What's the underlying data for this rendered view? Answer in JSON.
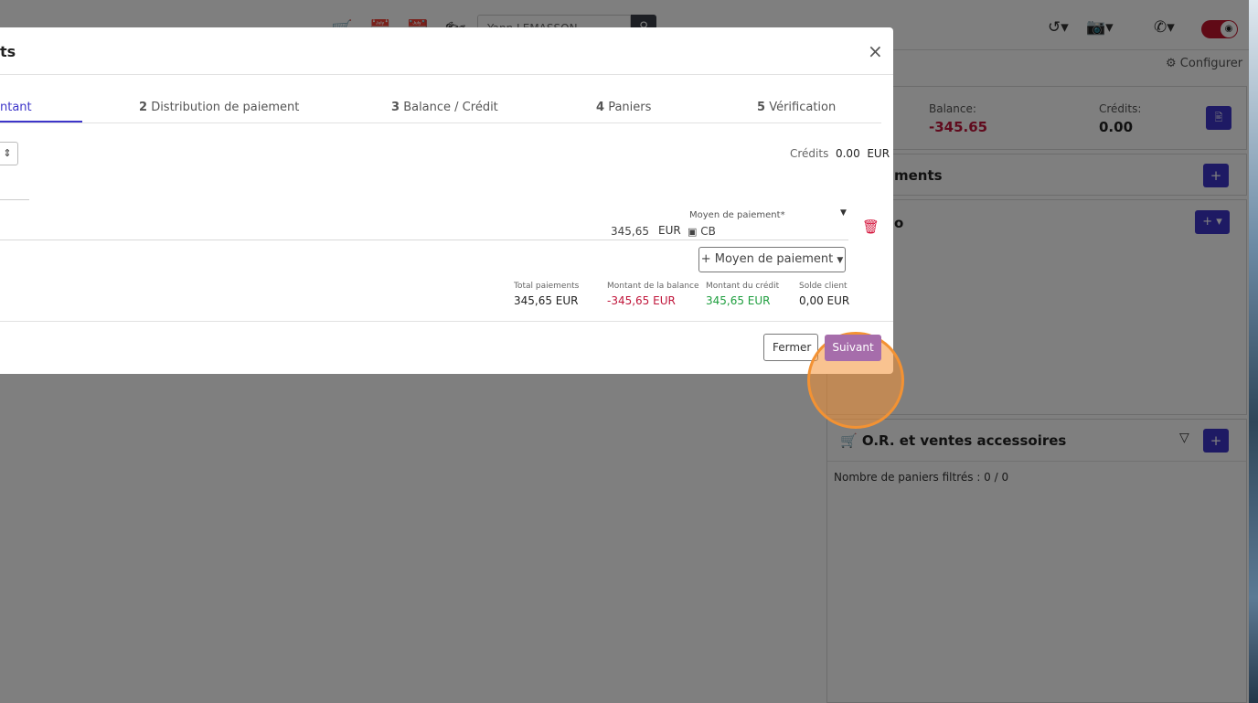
{
  "app": {
    "search": {
      "value": "Yann LEMASSON",
      "button_icon": "search-icon"
    },
    "toolbar_icons": [
      "cart-icon",
      "calendar-icon",
      "calendar-check-icon",
      "motorcycle-icon",
      "history-icon",
      "camera-icon",
      "phone-icon"
    ],
    "configure_label": "Configurer",
    "balance_card": {
      "balance_label": "Balance:",
      "balance_value": "-345.65",
      "credits_label": "Crédits:",
      "credits_value": "0.00"
    },
    "panels": {
      "payments_title": "ments",
      "info_title": "o",
      "orders_title": "O.R. et ventes accessoires",
      "orders_filter_text": "Nombre de paniers filtrés : 0 / 0"
    },
    "colors": {
      "accent": "#3d35c9",
      "negative": "#c0153a",
      "positive": "#1e9e3e",
      "danger": "#d4143b",
      "next_button": "#a66dab",
      "highlight": "#f39233"
    }
  },
  "modal": {
    "title": "ts",
    "close_label": "×",
    "steps": [
      {
        "num": "",
        "label": "ntant"
      },
      {
        "num": "2",
        "label": "Distribution de paiement"
      },
      {
        "num": "3",
        "label": "Balance / Crédit"
      },
      {
        "num": "4",
        "label": "Paniers"
      },
      {
        "num": "5",
        "label": "Vérification"
      }
    ],
    "credits_label": "Crédits",
    "credits_value": "0.00",
    "credits_currency": "EUR",
    "payment_line": {
      "amount": "345,65",
      "currency": "EUR",
      "method_label": "Moyen de paiement*",
      "method_value": "CB"
    },
    "add_payment_label": "Moyen de paiement",
    "totals": [
      {
        "label": "Total paiements",
        "value": "345,65 EUR"
      },
      {
        "label": "Montant de la balance",
        "value": "-345,65 EUR"
      },
      {
        "label": "Montant du crédit",
        "value": "345,65 EUR"
      },
      {
        "label": "Solde client",
        "value": "0,00 EUR"
      }
    ],
    "close_button_label": "Fermer",
    "next_button_label": "Suivant"
  }
}
